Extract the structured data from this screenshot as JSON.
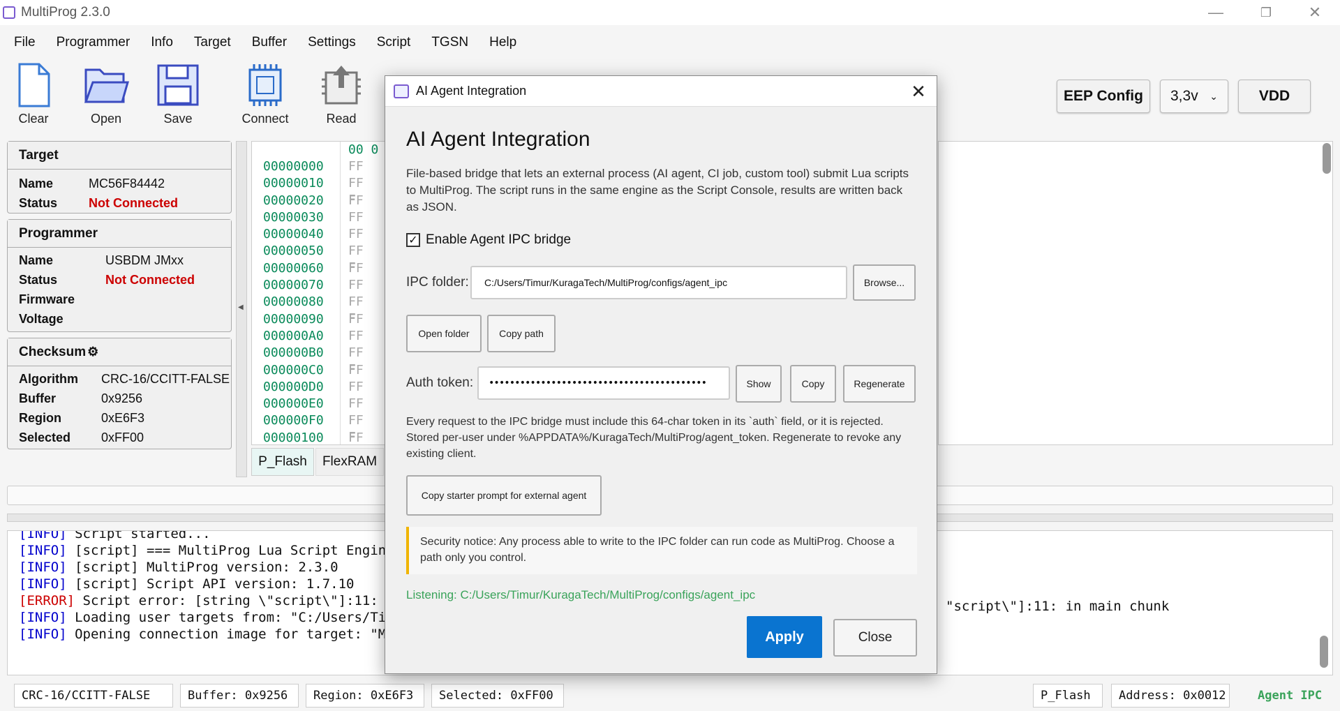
{
  "window": {
    "title": "MultiProg 2.3.0",
    "minimize": "—",
    "restore": "❐",
    "close": "✕"
  },
  "menu": [
    "File",
    "Programmer",
    "Info",
    "Target",
    "Buffer",
    "Settings",
    "Script",
    "TGSN",
    "Help"
  ],
  "toolbar": {
    "clear": "Clear",
    "open": "Open",
    "save": "Save",
    "connect": "Connect",
    "read": "Read"
  },
  "topright": {
    "eep_config": "EEP Config",
    "voltage": "3,3v",
    "vdd": "VDD"
  },
  "target": {
    "header": "Target",
    "name_label": "Name",
    "name": "MC56F84442",
    "status_label": "Status",
    "status": "Not Connected"
  },
  "programmer": {
    "header": "Programmer",
    "name_label": "Name",
    "name": "USBDM JMxx",
    "status_label": "Status",
    "status": "Not Connected",
    "firmware_label": "Firmware",
    "voltage_label": "Voltage"
  },
  "checksum": {
    "header": "Checksum",
    "algorithm_label": "Algorithm",
    "algorithm": "CRC-16/CCITT-FALSE",
    "buffer_label": "Buffer",
    "buffer": "0x9256",
    "region_label": "Region",
    "region": "0xE6F3",
    "selected_label": "Selected",
    "selected": "0xFF00"
  },
  "hex": {
    "header": "00 0",
    "addresses": [
      "00000000",
      "00000010",
      "00000020",
      "00000030",
      "00000040",
      "00000050",
      "00000060",
      "00000070",
      "00000080",
      "00000090",
      "000000A0",
      "000000B0",
      "000000C0",
      "000000D0",
      "000000E0",
      "000000F0",
      "00000100"
    ],
    "cell": "FF F"
  },
  "tabs": {
    "p_flash": "P_Flash",
    "flexram": "FlexRAM"
  },
  "log": [
    {
      "tag": "[INFO]",
      "text": " Script started...",
      "error": false
    },
    {
      "tag": "[INFO]",
      "text": " [script] === MultiProg Lua Script Engine =",
      "error": false
    },
    {
      "tag": "[INFO]",
      "text": " [script] MultiProg version: 2.3.0",
      "error": false
    },
    {
      "tag": "[INFO]",
      "text": " [script] Script API version: 1.7.10",
      "error": false
    },
    {
      "tag": "[ERROR]",
      "text": " Script error: [string \\\"script\\\"]:11: Scr",
      "error": true
    },
    {
      "tag": "[INFO]",
      "text": " Loading user targets from: \"C:/Users/Timur",
      "error": false
    },
    {
      "tag": "[INFO]",
      "text": " Opening connection image for target: \"MC56",
      "error": false
    }
  ],
  "log_overflow": "\"script\\\"]:11: in main chunk",
  "statusbar": {
    "crc": "CRC-16/CCITT-FALSE",
    "buffer": "Buffer: 0x9256",
    "region": "Region: 0xE6F3",
    "selected": "Selected: 0xFF00",
    "region_name": "P_Flash",
    "address": "Address: 0x0012",
    "agent": "Agent IPC"
  },
  "dialog": {
    "title": "AI Agent Integration",
    "heading": "AI Agent Integration",
    "description": "File-based bridge that lets an external process (AI agent, CI job, custom tool) submit Lua scripts to MultiProg. The script runs in the same engine as the Script Console, results are written back as JSON.",
    "enable_label": "Enable Agent IPC bridge",
    "enable_checked": true,
    "ipc_folder_label": "IPC folder:",
    "ipc_folder": "C:/Users/Timur/KuragaTech/MultiProg/configs/agent_ipc",
    "browse": "Browse...",
    "open_folder": "Open folder",
    "copy_path": "Copy path",
    "auth_label": "Auth token:",
    "auth_value": "••••••••••••••••••••••••••••••••••••••••••",
    "show": "Show",
    "copy": "Copy",
    "regenerate": "Regenerate",
    "token_note": "Every request to the IPC bridge must include this 64-char token in its `auth` field, or it is rejected. Stored per-user under %APPDATA%/KuragaTech/MultiProg/agent_token. Regenerate to revoke any existing client.",
    "copy_prompt": "Copy starter prompt for external agent",
    "security": "Security notice: Any process able to write to the IPC folder can run code as MultiProg. Choose a path only you control.",
    "listening": "Listening: C:/Users/Timur/KuragaTech/MultiProg/configs/agent_ipc",
    "apply": "Apply",
    "close": "Close"
  },
  "colors": {
    "accent": "#0a74d0",
    "error": "#cc0000",
    "info": "#0000cc",
    "listening": "#3aa35a",
    "addr": "#0a8a5a"
  }
}
